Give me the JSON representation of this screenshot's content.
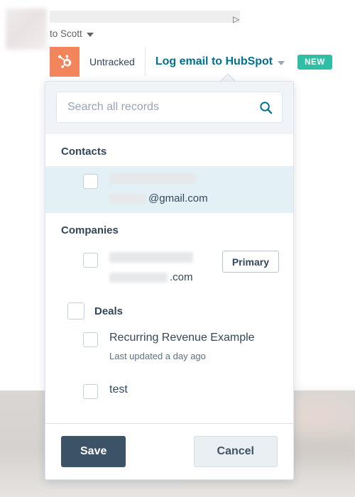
{
  "mail_header": {
    "avatar": "blurred-avatar",
    "subject_redacted": true,
    "reply_arrow_icon": "▷",
    "recipient_label": "to Scott",
    "recipient_caret_icon": "caret-down-icon"
  },
  "hubspot_toolbar": {
    "logo_icon": "hubspot-sprocket-icon",
    "logo_bg": "#f2855c",
    "tracking_status": "Untracked",
    "log_link_label": "Log email to HubSpot",
    "log_link_color": "#00718f",
    "log_link_caret_icon": "caret-down-icon",
    "new_badge_label": "NEW",
    "new_badge_color": "#2ebfa5"
  },
  "panel": {
    "search": {
      "placeholder": "Search all records",
      "value": "",
      "icon": "search-icon",
      "icon_color": "#00728f"
    },
    "sections": [
      {
        "id": "contacts",
        "title": "Contacts",
        "has_section_checkbox": false,
        "rows": [
          {
            "id": "contact-1",
            "selected": true,
            "checked": false,
            "name_redacted": true,
            "secondary_redacted_prefix": true,
            "secondary_text": "@gmail.com",
            "badge": null
          }
        ]
      },
      {
        "id": "companies",
        "title": "Companies",
        "has_section_checkbox": false,
        "rows": [
          {
            "id": "company-1",
            "selected": false,
            "checked": false,
            "name_redacted": true,
            "secondary_redacted_prefix": true,
            "secondary_text": ".com",
            "badge": "Primary"
          }
        ]
      },
      {
        "id": "deals",
        "title": "Deals",
        "has_section_checkbox": true,
        "rows": [
          {
            "id": "deal-1",
            "checked": false,
            "title": "Recurring Revenue Example",
            "meta": "Last updated a day ago"
          },
          {
            "id": "deal-2",
            "checked": false,
            "title": "test",
            "meta": ""
          }
        ]
      }
    ],
    "footer": {
      "save_label": "Save",
      "save_bg": "#3c5267",
      "cancel_label": "Cancel",
      "cancel_bg": "#eaeff4"
    }
  }
}
